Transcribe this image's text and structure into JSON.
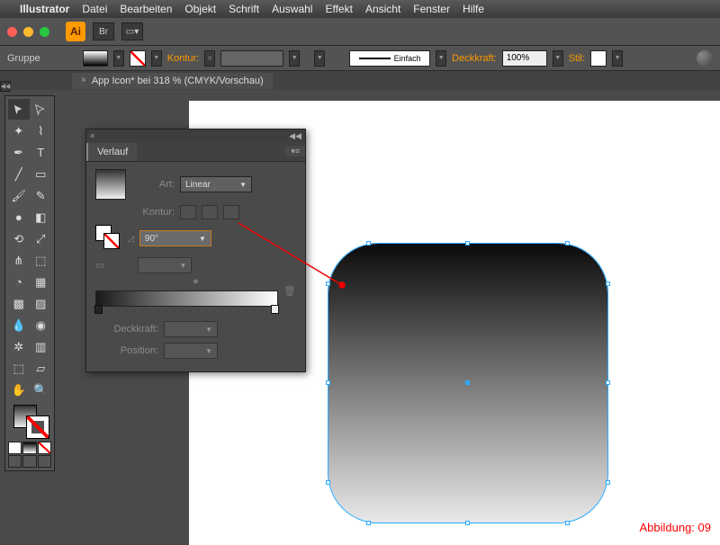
{
  "menu": {
    "app": "Illustrator",
    "items": [
      "Datei",
      "Bearbeiten",
      "Objekt",
      "Schrift",
      "Auswahl",
      "Effekt",
      "Ansicht",
      "Fenster",
      "Hilfe"
    ]
  },
  "app_logo": "Ai",
  "control": {
    "selection": "Gruppe",
    "kontur": "Kontur:",
    "stroke_style": "Einfach",
    "deckkraft": "Deckkraft:",
    "opacity_value": "100%",
    "stil": "Stil:"
  },
  "tab": {
    "title": "App Icon* bei 318 % (CMYK/Vorschau)"
  },
  "panel": {
    "title": "Verlauf",
    "art_label": "Art:",
    "art_value": "Linear",
    "kontur_label": "Kontur:",
    "angle_value": "90°",
    "deckkraft_label": "Deckkraft:",
    "position_label": "Position:"
  },
  "caption": "Abbildung: 09"
}
